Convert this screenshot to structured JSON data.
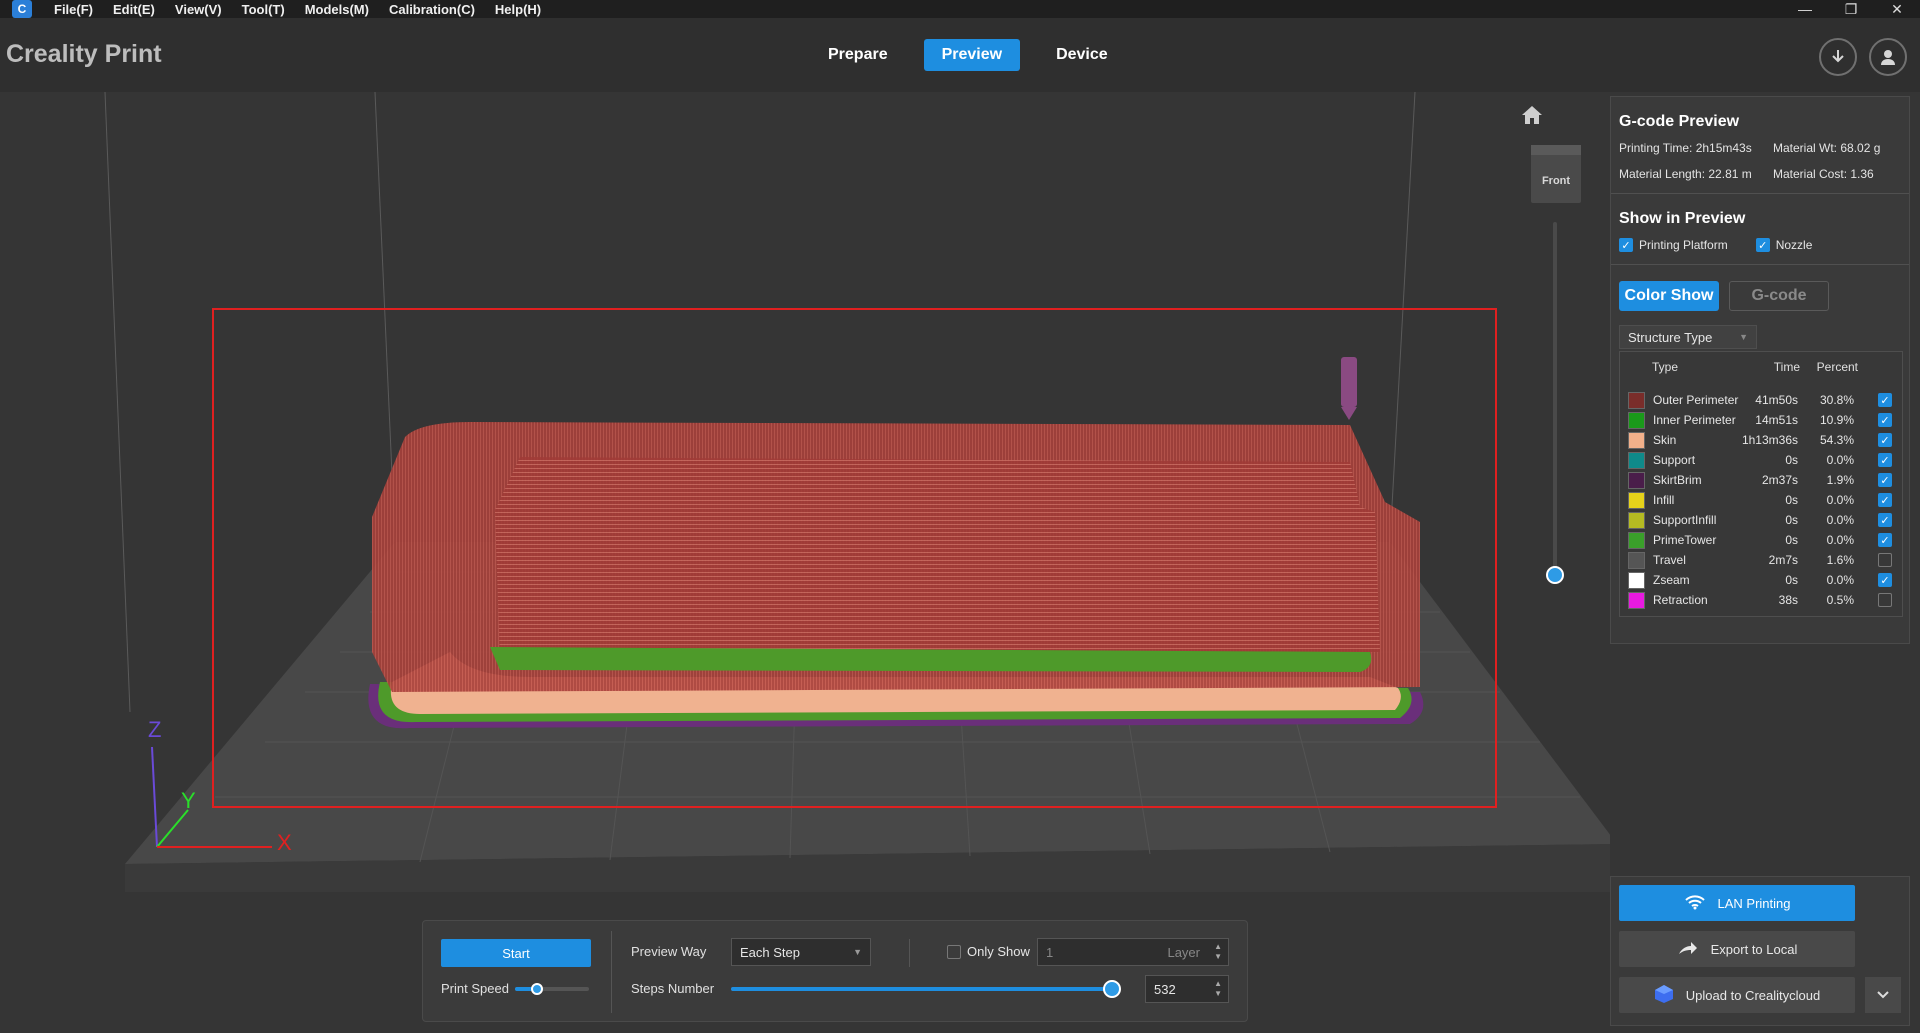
{
  "titlebar": {
    "menus": [
      "File(F)",
      "Edit(E)",
      "View(V)",
      "Tool(T)",
      "Models(M)",
      "Calibration(C)",
      "Help(H)"
    ],
    "minimize": "—",
    "restore": "❐",
    "close": "✕"
  },
  "header": {
    "brand": "Creality Print",
    "tabs": [
      {
        "label": "Prepare",
        "active": false
      },
      {
        "label": "Preview",
        "active": true
      },
      {
        "label": "Device",
        "active": false
      }
    ]
  },
  "viewport": {
    "viewcube_face": "Front",
    "axes": {
      "x": "X",
      "y": "Y",
      "z": "Z"
    }
  },
  "gcode_preview": {
    "title": "G-code Preview",
    "printing_time": "Printing Time: 2h15m43s",
    "material_wt": "Material Wt: 68.02 g",
    "material_length": "Material Length: 22.81 m",
    "material_cost": "Material Cost: 1.36"
  },
  "show_in_preview": {
    "title": "Show in Preview",
    "printing_platform": "Printing Platform",
    "nozzle": "Nozzle"
  },
  "color_mode": {
    "color_show": "Color Show",
    "gcode": "G-code"
  },
  "structure": {
    "select_label": "Structure Type",
    "headers": {
      "type": "Type",
      "time": "Time",
      "percent": "Percent"
    },
    "rows": [
      {
        "type": "Outer Perimeter",
        "time": "41m50s",
        "percent": "30.8%",
        "color": "#7a2d2a",
        "checked": true
      },
      {
        "type": "Inner Perimeter",
        "time": "14m51s",
        "percent": "10.9%",
        "color": "#1a9a1a",
        "checked": true
      },
      {
        "type": "Skin",
        "time": "1h13m36s",
        "percent": "54.3%",
        "color": "#f2b08a",
        "checked": true
      },
      {
        "type": "Support",
        "time": "0s",
        "percent": "0.0%",
        "color": "#0f8a8a",
        "checked": true
      },
      {
        "type": "SkirtBrim",
        "time": "2m37s",
        "percent": "1.9%",
        "color": "#4a1d4a",
        "checked": true
      },
      {
        "type": "Infill",
        "time": "0s",
        "percent": "0.0%",
        "color": "#e6d21a",
        "checked": true
      },
      {
        "type": "SupportInfill",
        "time": "0s",
        "percent": "0.0%",
        "color": "#b5bb22",
        "checked": true
      },
      {
        "type": "PrimeTower",
        "time": "0s",
        "percent": "0.0%",
        "color": "#3aa02a",
        "checked": true
      },
      {
        "type": "Travel",
        "time": "2m7s",
        "percent": "1.6%",
        "color": "#555555",
        "checked": false
      },
      {
        "type": "Zseam",
        "time": "0s",
        "percent": "0.0%",
        "color": "#ffffff",
        "checked": true
      },
      {
        "type": "Retraction",
        "time": "38s",
        "percent": "0.5%",
        "color": "#e81ae0",
        "checked": false
      }
    ]
  },
  "export": {
    "lan": "LAN Printing",
    "local": "Export to Local",
    "cloud": "Upload to Crealitycloud"
  },
  "controls": {
    "start": "Start",
    "print_speed": "Print Speed",
    "print_speed_level": 0.3,
    "preview_way_label": "Preview Way",
    "preview_way_value": "Each Step",
    "only_show": "Only Show",
    "layer_value": "1",
    "layer_unit": "Layer",
    "steps_label": "Steps Number",
    "steps_value": "532",
    "steps_fraction": 1.0
  }
}
